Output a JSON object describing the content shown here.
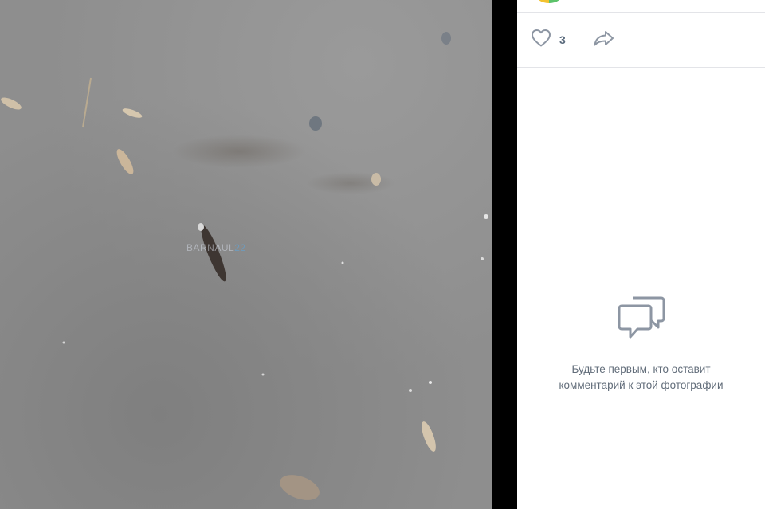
{
  "photo": {
    "watermark_main": "BARNAUL",
    "watermark_accent": "22"
  },
  "actions": {
    "likes_count": "3"
  },
  "comments": {
    "empty_line1": "Будьте первым, кто оставит",
    "empty_line2": "комментарий к этой фотографии"
  },
  "colors": {
    "accent": "#5b6b7d",
    "icon": "#8d96a3",
    "divider": "#e3e4e8",
    "panel_bg": "#ffffff",
    "backdrop": "#000000"
  },
  "icons": {
    "like": "heart-icon",
    "share": "share-arrow-icon",
    "comments_empty": "comment-bubbles-icon"
  }
}
